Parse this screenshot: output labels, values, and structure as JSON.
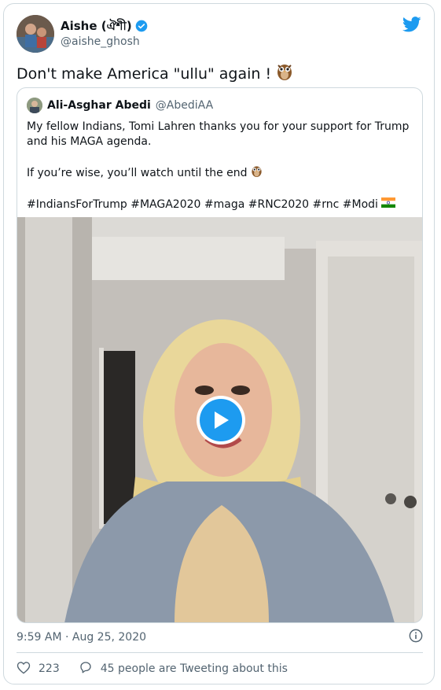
{
  "author": {
    "name": "Aishe (ঐশী)",
    "handle": "@aishe_ghosh"
  },
  "tweet": {
    "text": "Don't make America \"ullu\" again !"
  },
  "quoted": {
    "name": "Ali-Asghar Abedi",
    "handle": "@AbediAA",
    "line1": "My fellow Indians, Tomi Lahren thanks you for your support for Trump and his MAGA agenda.",
    "line2": "If you’re wise, you’ll watch until the end",
    "hashtags": "#IndiansForTrump #MAGA2020 #maga #RNC2020 #rnc #Modi"
  },
  "meta": {
    "timestamp": "9:59 AM · Aug 25, 2020"
  },
  "stats": {
    "likes": "223",
    "retweeting": "45 people are Tweeting about this"
  },
  "colors": {
    "accent": "#1d9bf0",
    "muted": "#536471",
    "border": "#cfd9de"
  }
}
